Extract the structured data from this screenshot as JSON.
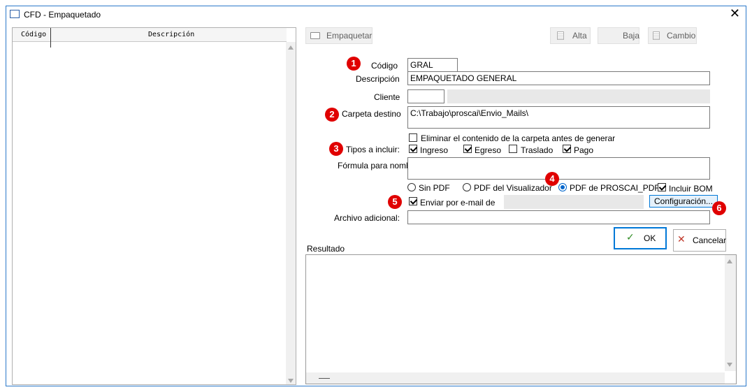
{
  "window": {
    "title": "CFD - Empaquetado"
  },
  "grid": {
    "columns": [
      "Código",
      "Descripción"
    ]
  },
  "toolbar": {
    "empaquetar": "Empaquetar",
    "alta": "Alta",
    "baja": "Baja",
    "cambio": "Cambio"
  },
  "form": {
    "codigo_label": "Código",
    "codigo_value": "GRAL",
    "descripcion_label": "Descripción",
    "descripcion_value": "EMPAQUETADO GENERAL",
    "cliente_label": "Cliente",
    "cliente_value": "",
    "carpeta_label": "Carpeta destino",
    "carpeta_value": "C:\\Trabajo\\proscai\\Envio_Mails\\",
    "eliminar_label": "Eliminar el contenido de la carpeta antes de generar",
    "tipos_label": "Tipos a incluir:",
    "tipos": [
      {
        "label": "Ingreso",
        "checked": true
      },
      {
        "label": "Egreso",
        "checked": true
      },
      {
        "label": "Traslado",
        "checked": false
      },
      {
        "label": "Pago",
        "checked": true
      }
    ],
    "formula_label": "Fórmula para nombre",
    "formula_value": "",
    "pdf_options": [
      "Sin PDF",
      "PDF del Visualizador",
      "PDF de PROSCAI_PDF"
    ],
    "pdf_selected": "PDF de PROSCAI_PDF",
    "incluir_bom_label": "Incluir BOM",
    "enviar_label": "Enviar por e-mail de",
    "configuracion_label": "Configuración...",
    "archivo_label": "Archivo adicional:",
    "archivo_value": ""
  },
  "actions": {
    "ok": "OK",
    "cancelar": "Cancelar"
  },
  "resultado_label": "Resultado",
  "badges": [
    "1",
    "2",
    "3",
    "4",
    "5",
    "6"
  ],
  "colors": {
    "badge": "#e00000",
    "accent": "#0078d7",
    "ok_check": "#2e8b22",
    "cancel_x": "#c0392b"
  }
}
